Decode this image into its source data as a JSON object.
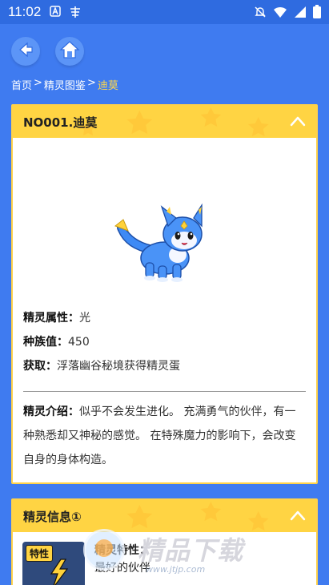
{
  "status_bar": {
    "time": "11:02",
    "app_icons": [
      "a-app-icon",
      "han-app-icon"
    ],
    "right_icons": [
      "mute-icon",
      "wifi-icon",
      "signal-icon",
      "battery-icon"
    ]
  },
  "nav": {
    "back_icon": "back-arrow-icon",
    "home_icon": "home-icon"
  },
  "breadcrumb": {
    "home": "首页",
    "sep1": ">",
    "catalog": "精灵图鉴",
    "sep2": ">",
    "current": "迪莫"
  },
  "detail_card": {
    "title": "NO001.迪莫",
    "collapse_icon": "chevron-up-icon",
    "attribute_label": "精灵属性：",
    "attribute_value": "光",
    "stats_label": "种族值：",
    "stats_value": "450",
    "obtain_label": "获取：",
    "obtain_value": "浮落幽谷秘境获得精灵蛋",
    "intro_label": "精灵介绍：",
    "intro_text": "似乎不会发生进化。 充满勇气的伙伴，有一种熟悉却又神秘的感觉。 在特殊魔力的影响下，会改变自身的身体构造。"
  },
  "info_card": {
    "title": "精灵信息①",
    "collapse_icon": "chevron-up-icon",
    "thumb_badge": "特性",
    "trait_label": "精灵特性：",
    "trait_value": "最好的伙伴"
  },
  "watermark": {
    "text": "精品下载",
    "url": "www.jtjp.com"
  },
  "colors": {
    "background": "#3F7BF0",
    "card_header": "#FFD443",
    "breadcrumb_current": "#FFD84A"
  }
}
